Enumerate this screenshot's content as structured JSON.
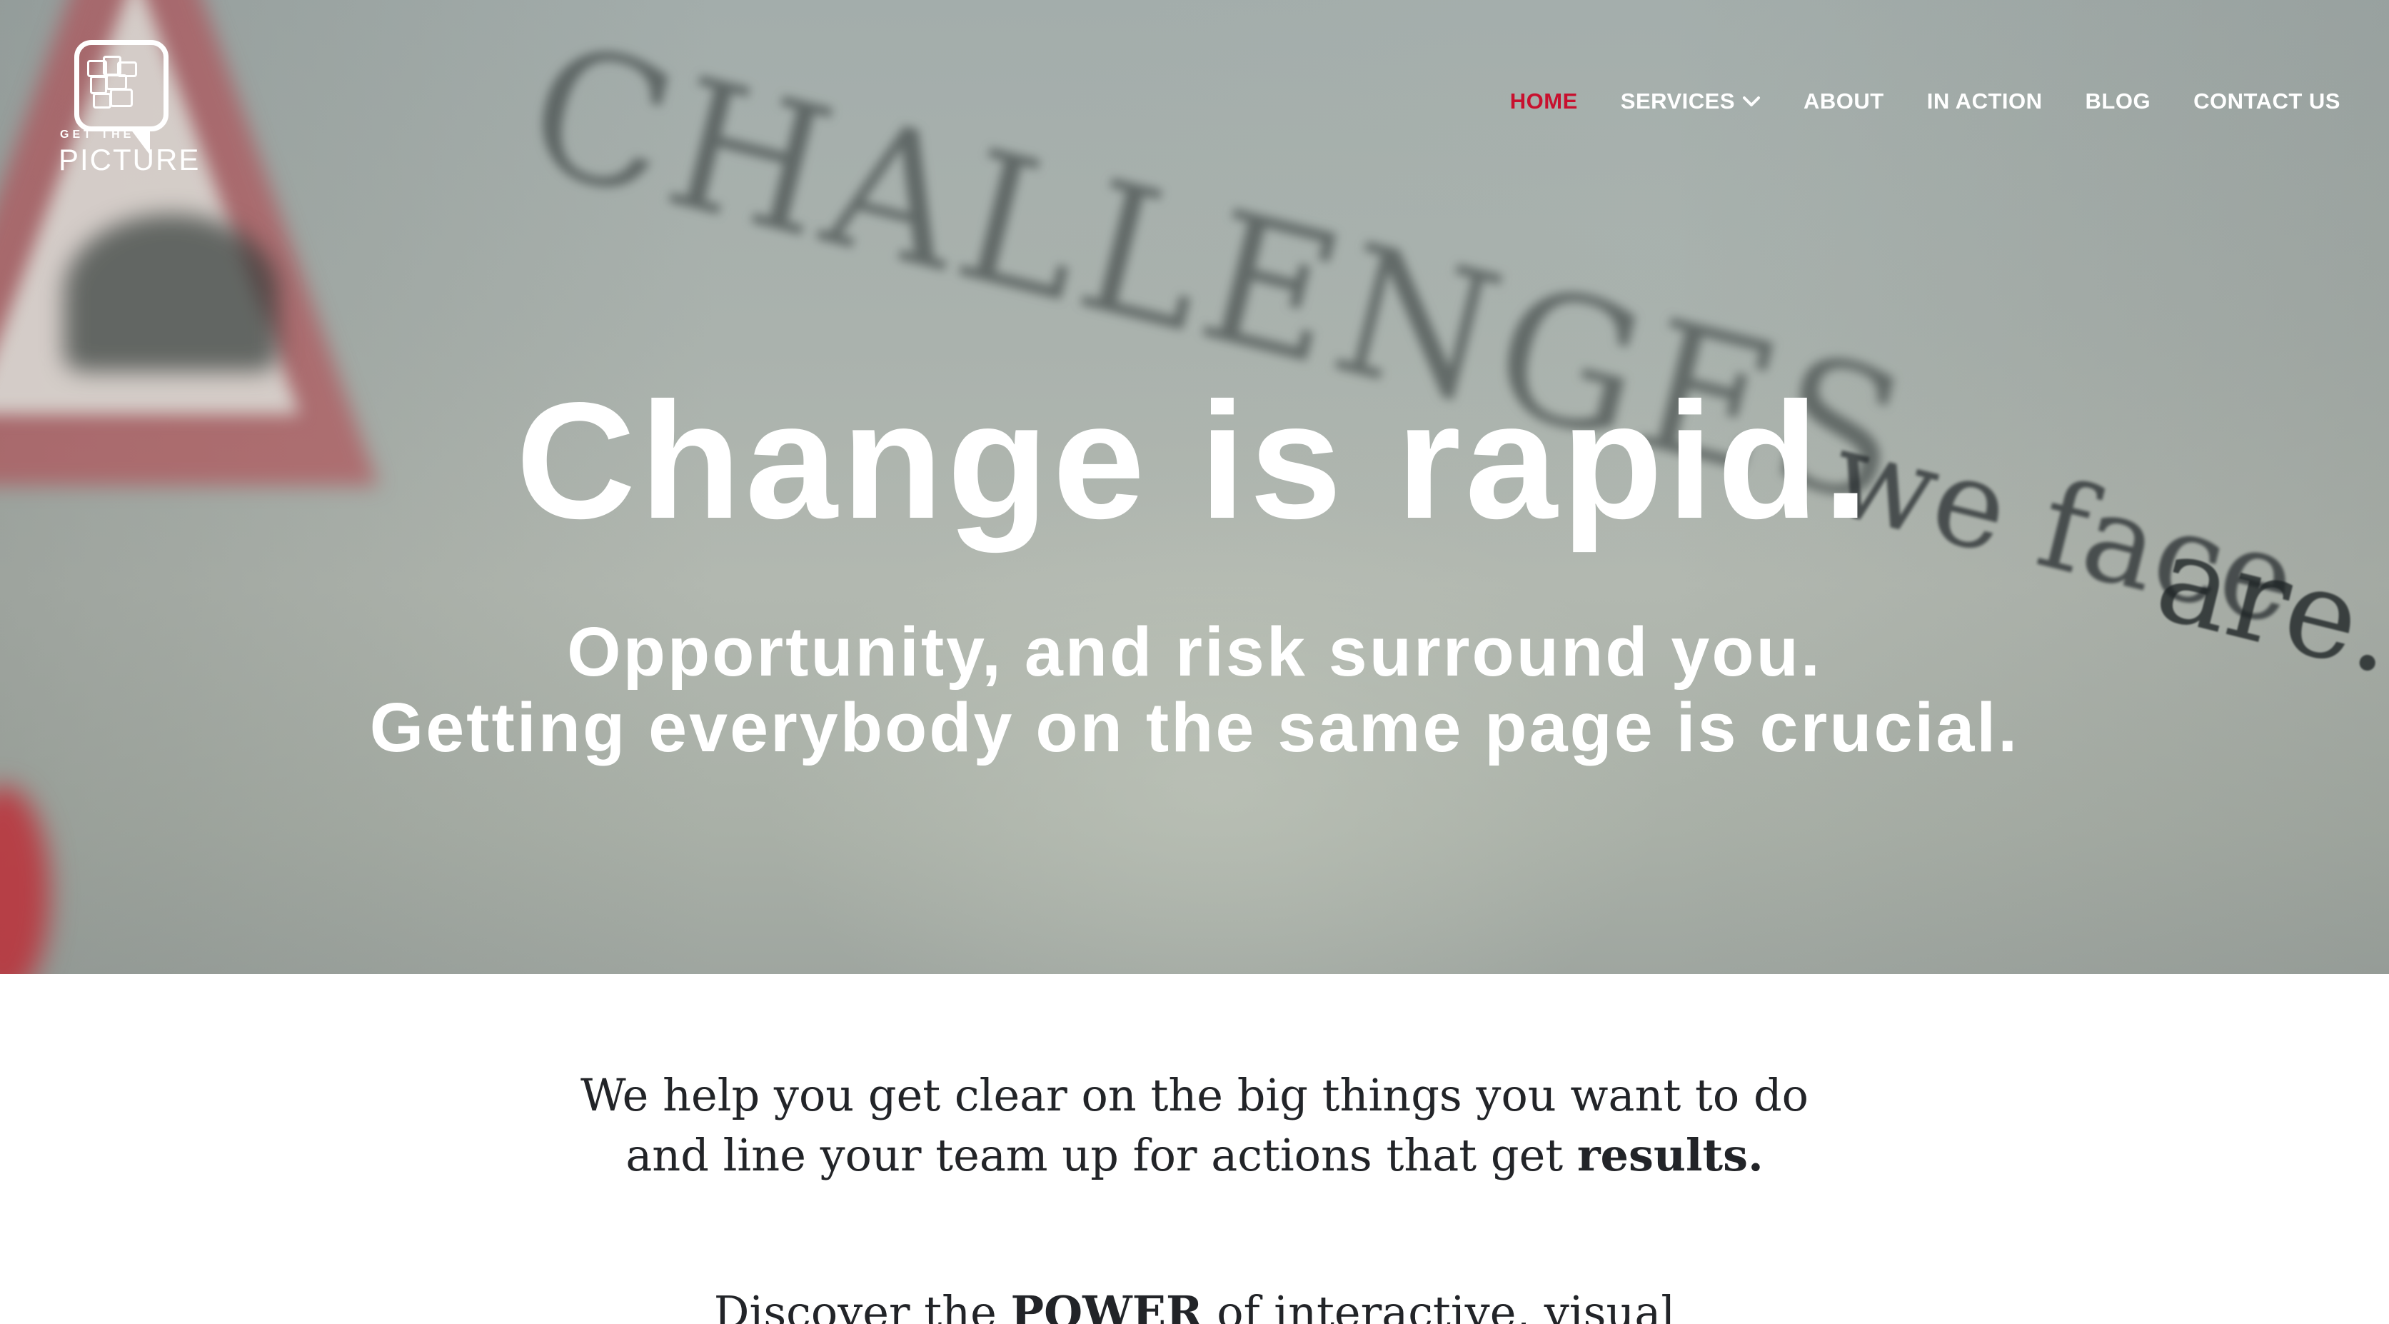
{
  "brand": {
    "logo_small": "GET THE",
    "logo_big": "PICTURE"
  },
  "nav": {
    "items": [
      {
        "label": "HOME",
        "active": true
      },
      {
        "label": "SERVICES",
        "has_dropdown": true
      },
      {
        "label": "ABOUT"
      },
      {
        "label": "IN ACTION"
      },
      {
        "label": "BLOG"
      },
      {
        "label": "CONTACT US"
      }
    ]
  },
  "hero": {
    "title": "Change is rapid.",
    "sub_line1": "Opportunity, and risk surround you.",
    "sub_line2": "Getting everybody on the same page is crucial.",
    "background_scribble": {
      "word1": "CHALLENGES",
      "word2": "we face",
      "word3": "are..."
    }
  },
  "intro": {
    "line1": "We help you get clear on the big things you want to do",
    "line2_prefix": "and line your team up for actions that get ",
    "line2_bold": "results."
  },
  "discover": {
    "prefix": "Discover the ",
    "bold": "POWER",
    "suffix": " of interactive, visual"
  },
  "colors": {
    "accent_red": "#c8102e",
    "text_dark": "#222428",
    "white": "#ffffff"
  }
}
